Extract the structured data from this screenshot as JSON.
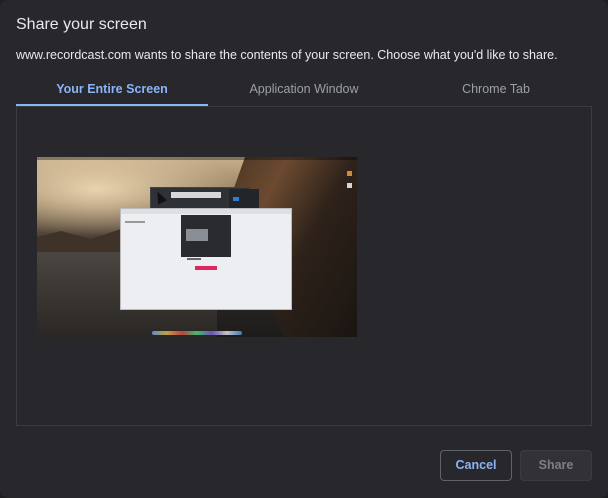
{
  "dialog": {
    "title": "Share your screen",
    "description": "www.recordcast.com wants to share the contents of your screen. Choose what you'd like to share."
  },
  "tabs": [
    {
      "label": "Your Entire Screen",
      "active": true
    },
    {
      "label": "Application Window",
      "active": false
    },
    {
      "label": "Chrome Tab",
      "active": false
    }
  ],
  "buttons": {
    "cancel_label": "Cancel",
    "share_label": "Share",
    "share_enabled": false
  },
  "colors": {
    "accent": "#8ab4f8",
    "background": "#28282c",
    "text": "#e8eaed",
    "muted_text": "#9aa0a6",
    "border": "#3c3c40"
  }
}
